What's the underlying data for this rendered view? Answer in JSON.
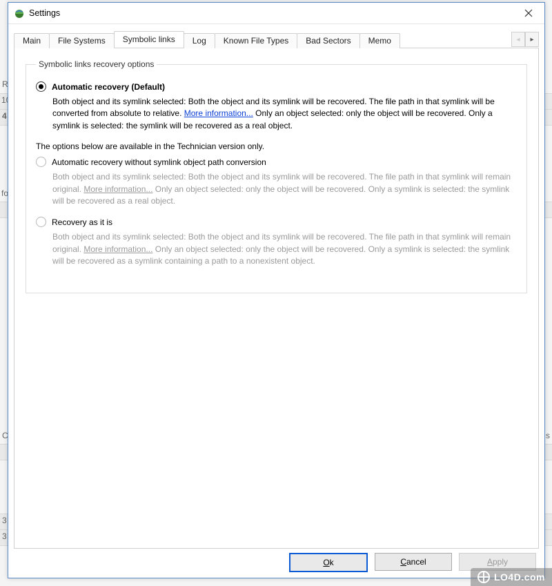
{
  "window": {
    "title": "Settings"
  },
  "tabs": {
    "items": [
      {
        "label": "Main"
      },
      {
        "label": "File Systems"
      },
      {
        "label": "Symbolic links"
      },
      {
        "label": "Log"
      },
      {
        "label": "Known File Types"
      },
      {
        "label": "Bad Sectors"
      },
      {
        "label": "Memo"
      }
    ],
    "active_index": 2
  },
  "panel": {
    "group_title": "Symbolic links recovery options",
    "tech_note": "The options below are available in the Technician version only.",
    "options": [
      {
        "label": "Automatic recovery (Default)",
        "checked": true,
        "disabled": false,
        "desc_before": "Both object and its symlink selected: Both the object and its symlink will be recovered. The file path in that symlink will be converted from absolute to relative. ",
        "link": "More information...",
        "desc_after": " Only an object selected: only the object will be recovered. Only a symlink is selected: the symlink will be recovered as a real object."
      },
      {
        "label": "Automatic recovery without symlink object path conversion",
        "checked": false,
        "disabled": true,
        "desc_before": "Both object and its symlink selected: Both the object and its symlink will be recovered. The file path in that symlink will remain original. ",
        "link": "More information...",
        "desc_after": " Only an object selected: only the object will be recovered. Only a symlink is selected: the symlink will be recovered as a real object."
      },
      {
        "label": "Recovery as it is",
        "checked": false,
        "disabled": true,
        "desc_before": "Both object and its symlink selected: Both the object and its symlink will be recovered. The file path in that symlink will remain original. ",
        "link": "More information...",
        "desc_after": " Only an object selected: only the object will be recovered. Only a symlink is selected: the symlink will be recovered as a symlink containing a path to a nonexistent object."
      }
    ]
  },
  "buttons": {
    "ok": "Ok",
    "cancel": "Cancel",
    "apply": "Apply"
  },
  "background": {
    "r_text": "R",
    "ten": "10",
    "four": "4",
    "fo": "fo",
    "c": "C",
    "s": "s",
    "three_a": "3",
    "three_b": "3"
  },
  "watermark": {
    "text": "LO4D.com"
  }
}
